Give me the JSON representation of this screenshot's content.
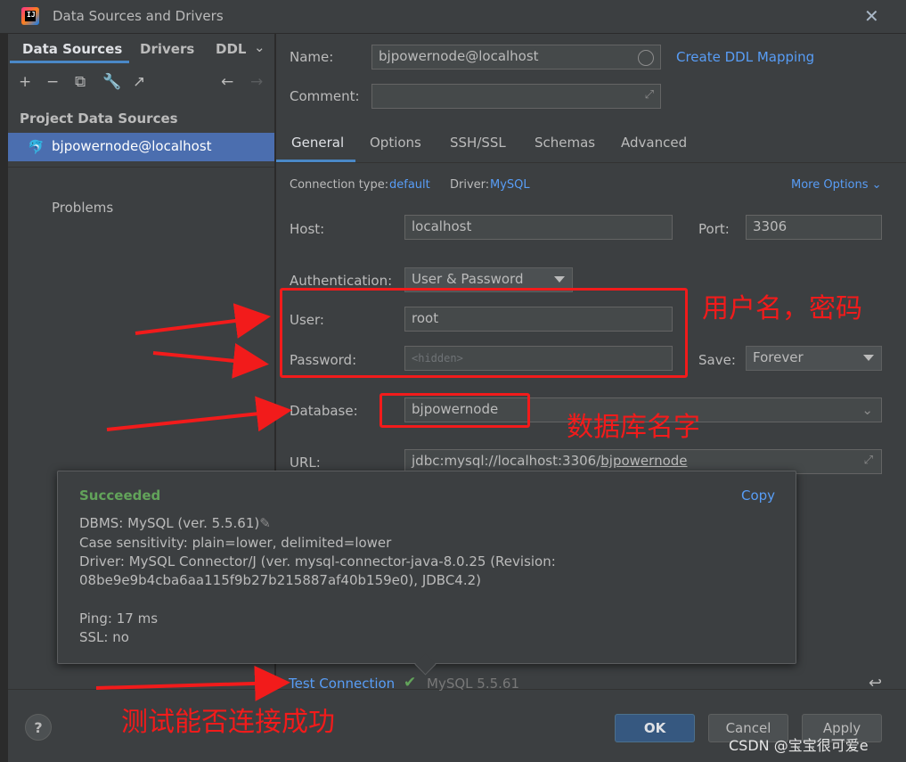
{
  "window": {
    "title": "Data Sources and Drivers",
    "logo_text": "IJ"
  },
  "sidebar": {
    "tabs": [
      "Data Sources",
      "Drivers",
      "DDL"
    ],
    "tools": [
      "+",
      "−",
      "⧉",
      "🔧",
      "↗",
      "←",
      "→"
    ],
    "section": "Project Data Sources",
    "selected_item": "bjpowernode@localhost",
    "problems": "Problems"
  },
  "form": {
    "name_label": "Name:",
    "name_value": "bjpowernode@localhost",
    "create_ddl": "Create DDL Mapping",
    "comment_label": "Comment:",
    "tabs": [
      "General",
      "Options",
      "SSH/SSL",
      "Schemas",
      "Advanced"
    ],
    "conn_type_label": "Connection type:",
    "conn_type_value": "default",
    "driver_label": "Driver:",
    "driver_value": "MySQL",
    "more_options": "More Options",
    "host_label": "Host:",
    "host_value": "localhost",
    "port_label": "Port:",
    "port_value": "3306",
    "auth_label": "Authentication:",
    "auth_value": "User & Password",
    "user_label": "User:",
    "user_value": "root",
    "password_label": "Password:",
    "password_placeholder": "<hidden>",
    "save_label": "Save:",
    "save_value": "Forever",
    "database_label": "Database:",
    "database_value": "bjpowernode",
    "url_label": "URL:",
    "url_prefix": "jdbc:mysql://localhost:3306/",
    "url_db": "bjpowernode"
  },
  "popup": {
    "status": "Succeeded",
    "copy": "Copy",
    "lines": [
      "DBMS: MySQL (ver. 5.5.61)",
      "Case sensitivity: plain=lower, delimited=lower",
      "Driver: MySQL Connector/J (ver. mysql-connector-java-8.0.25 (Revision:",
      "08be9e9b4cba6aa115f9b27b215887af40b159e0), JDBC4.2)",
      "Ping: 17 ms",
      "SSL: no"
    ]
  },
  "bottom": {
    "test_connection": "Test Connection",
    "test_result": "MySQL 5.5.61",
    "help": "?",
    "ok": "OK",
    "cancel": "Cancel",
    "apply": "Apply"
  },
  "annotations": {
    "user_pass": "用户名，密码",
    "db_name": "数据库名字",
    "test": "测试能否连接成功"
  },
  "watermark": "CSDN @宝宝很可爱e",
  "colors": {
    "accent": "#4a88c7",
    "link": "#589df6",
    "success": "#62a35a",
    "annotation": "#f21b1b"
  }
}
